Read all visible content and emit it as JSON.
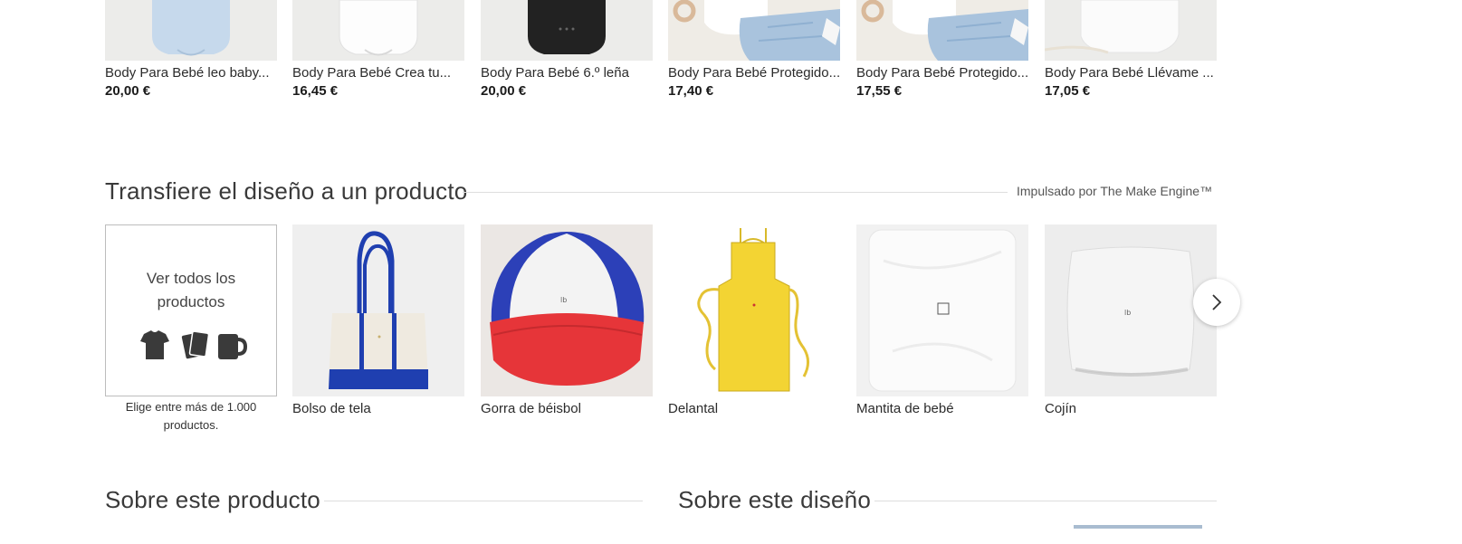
{
  "related_products": [
    {
      "title": "Body Para Bebé leo baby...",
      "price": "20,00 €",
      "image": "light-blue-baby-bodysuit"
    },
    {
      "title": "Body Para Bebé Crea tu...",
      "price": "16,45 €",
      "image": "white-baby-bodysuit"
    },
    {
      "title": "Body Para Bebé 6.º leña",
      "price": "20,00 €",
      "image": "black-baby-bodysuit"
    },
    {
      "title": "Body Para Bebé Protegido...",
      "price": "17,40 €",
      "image": "white-bodysuit-with-denim"
    },
    {
      "title": "Body Para Bebé Protegido...",
      "price": "17,55 €",
      "image": "white-bodysuit-with-denim"
    },
    {
      "title": "Body Para Bebé Llévame ...",
      "price": "17,05 €",
      "image": "white-bodysuit-with-lace"
    }
  ],
  "transfer_section": {
    "heading": "Transfiere el diseño a un producto",
    "powered_by": "Impulsado por The Make Engine™",
    "see_all": {
      "label": "Ver todos los productos",
      "caption": "Elige entre más de 1.000 productos.",
      "icons": [
        "tshirt-icon",
        "cards-icon",
        "mug-icon"
      ]
    },
    "products": [
      {
        "label": "Bolso de tela",
        "image": "tote-bag"
      },
      {
        "label": "Gorra de béisbol",
        "image": "trucker-cap"
      },
      {
        "label": "Delantal",
        "image": "yellow-apron"
      },
      {
        "label": "Mantita de bebé",
        "image": "baby-blanket"
      },
      {
        "label": "Cojín",
        "image": "pillow"
      }
    ],
    "next_icon": "chevron-right-icon"
  },
  "about_product": {
    "heading": "Sobre este producto"
  },
  "about_design": {
    "heading": "Sobre este diseño"
  },
  "colors": {
    "bodysuit_blue": "#c6d9ec",
    "cap_blue": "#2c40b8",
    "cap_red": "#e63539",
    "apron_yellow": "#f3d433",
    "tote_blue": "#1f3fb0"
  }
}
